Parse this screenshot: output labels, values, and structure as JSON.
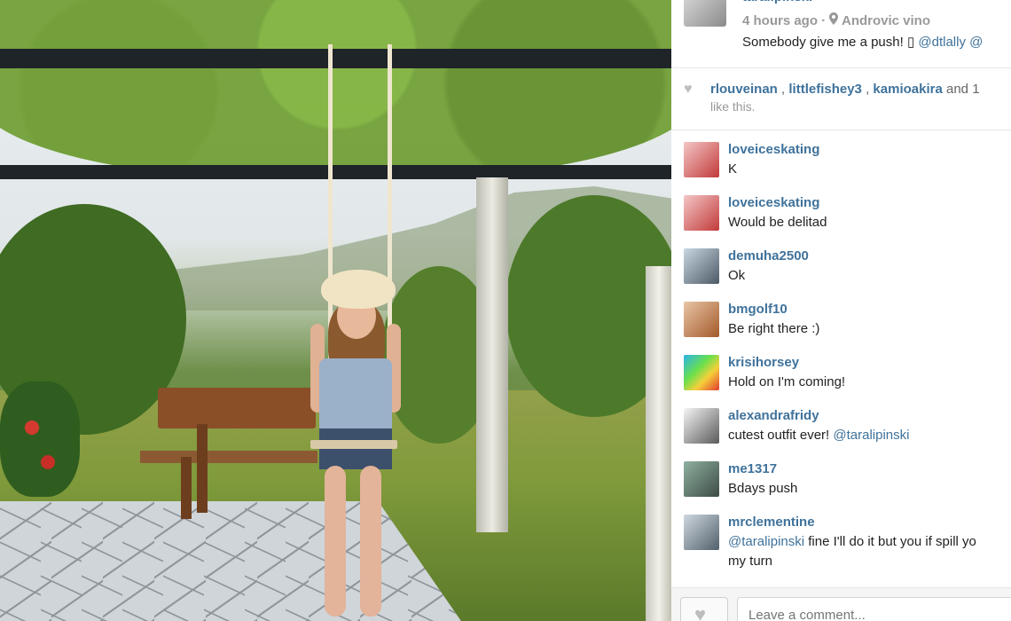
{
  "post": {
    "owner_name": "taralipinski",
    "time_ago": "4 hours ago",
    "separator": "·",
    "location": "Androvic vino",
    "caption_text": "Somebody give me a push! ",
    "caption_glyph": "▯",
    "caption_mentions": [
      "@dtlally",
      "@"
    ]
  },
  "likes": {
    "users": [
      "rlouveinan",
      "littlefishey3",
      "kamioakira"
    ],
    "tail_text": " and ",
    "tail_count": "1",
    "line2": "like this."
  },
  "comments": [
    {
      "user": "loveiceskating",
      "text": "K"
    },
    {
      "user": "loveiceskating",
      "text": "Would be delitad"
    },
    {
      "user": "demuha2500",
      "text": "Ok"
    },
    {
      "user": "bmgolf10",
      "text": "Be right there :)"
    },
    {
      "user": "krisihorsey",
      "text": "Hold on I'm coming!"
    },
    {
      "user": "alexandrafridy",
      "text_prefix": "cutest outfit ever! ",
      "mention": "@taralipinski"
    },
    {
      "user": "me1317",
      "text": "Bdays push"
    },
    {
      "user": "mrclementine",
      "mention": "@taralipinski",
      "text_suffix": " fine I'll do it but you if spill yo",
      "line2": "my turn"
    }
  ],
  "footer": {
    "comment_placeholder": "Leave a comment..."
  },
  "colors": {
    "link_blue": "#3f729b",
    "meta_gray": "#999999"
  },
  "icons": {
    "heart": "heart-icon",
    "location": "location-pin-icon"
  }
}
